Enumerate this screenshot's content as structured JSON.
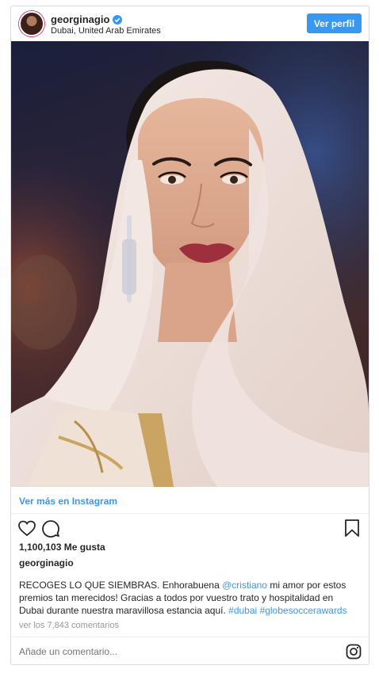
{
  "header": {
    "username": "georginagio",
    "location": "Dubai, United Arab Emirates",
    "view_profile_label": "Ver perfil"
  },
  "post": {
    "see_more_label": "Ver más en Instagram",
    "likes": "1,100,103 Me gusta",
    "author": "georginagio",
    "caption": {
      "part1": "RECOGES LO QUE SIEMBRAS. Enhorabuena ",
      "mention": "@cristiano",
      "part2": " mi amor por estos premios tan merecidos! Gracias a todos por vuestro trato y hospitalidad en Dubai durante nuestra maravillosa estancia aquí. ",
      "hashtag1": "#dubai",
      "space": " ",
      "hashtag2": "#globesoccerawards"
    },
    "view_comments": "ver los 7,843 comentarios",
    "comment_placeholder": "Añade un comentario..."
  },
  "icons": {
    "heart": "heart-icon",
    "comment": "comment-icon",
    "save": "bookmark-icon",
    "verified": "verified-badge-icon",
    "instagram": "instagram-logo-icon"
  },
  "colors": {
    "accent": "#3897f0",
    "text": "#262626",
    "muted": "#999999",
    "border": "#dbdbdb"
  }
}
